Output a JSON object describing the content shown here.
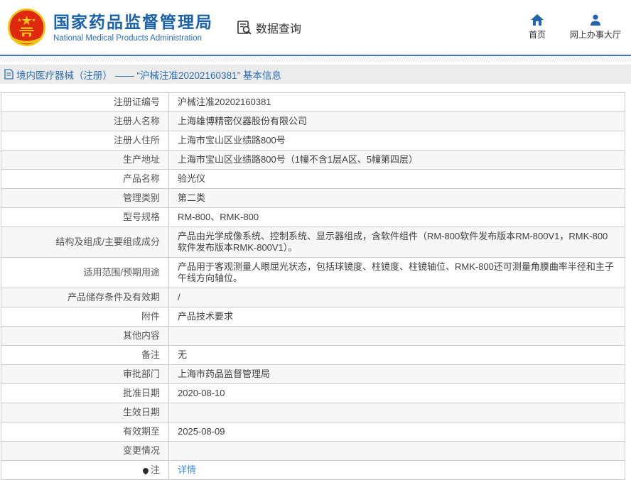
{
  "header": {
    "org_name_cn": "国家药品监督管理局",
    "org_name_en": "National Medical Products Administration",
    "section_label": "数据查询",
    "nav": [
      {
        "label": "首页",
        "icon": "home-icon"
      },
      {
        "label": "网上办事大厅",
        "icon": "user-icon"
      }
    ]
  },
  "breadcrumb": {
    "text": "境内医疗器械（注册） —— “沪械注准20202160381” 基本信息"
  },
  "table": {
    "rows": [
      {
        "label": "注册证编号",
        "value": "沪械注准20202160381"
      },
      {
        "label": "注册人名称",
        "value": "上海雄博精密仪器股份有限公司"
      },
      {
        "label": "注册人住所",
        "value": "上海市宝山区业绩路800号"
      },
      {
        "label": "生产地址",
        "value": "上海市宝山区业绩路800号（1幢不含1层A区、5幢第四层）"
      },
      {
        "label": "产品名称",
        "value": "验光仪"
      },
      {
        "label": "管理类别",
        "value": "第二类"
      },
      {
        "label": "型号规格",
        "value": "RM-800、RMK-800"
      },
      {
        "label": "结构及组成/主要组成成分",
        "value": "产品由光学成像系统、控制系统、显示器组成，含软件组件（RM-800软件发布版本RM-800V1，RMK-800软件发布版本RMK-800V1）。"
      },
      {
        "label": "适用范围/预期用途",
        "value": "产品用于客观测量人眼屈光状态，包括球镜度、柱镜度、柱镜轴位、RMK-800还可测量角膜曲率半径和主子午线方向轴位。"
      },
      {
        "label": "产品储存条件及有效期",
        "value": "/"
      },
      {
        "label": "附件",
        "value": "产品技术要求"
      },
      {
        "label": "其他内容",
        "value": ""
      },
      {
        "label": "备注",
        "value": "无"
      },
      {
        "label": "审批部门",
        "value": "上海市药品监督管理局"
      },
      {
        "label": "批准日期",
        "value": "2020-08-10"
      },
      {
        "label": "生效日期",
        "value": ""
      },
      {
        "label": "有效期至",
        "value": "2025-08-09"
      },
      {
        "label": "变更情况",
        "value": ""
      },
      {
        "label": "注",
        "value": "详情",
        "icon": "pin",
        "link": true
      }
    ]
  },
  "colors": {
    "brand_blue": "#1b62a9",
    "icon_blue": "#2463ad",
    "crumb_bg": "#ececec",
    "crumb_text": "#2b6cb0",
    "table_border": "#cccccc",
    "alt_row_bg": "#f7f7f7",
    "link_blue": "#3e8ddd",
    "emblem_red": "#de2910",
    "emblem_gold": "#f0c616"
  }
}
